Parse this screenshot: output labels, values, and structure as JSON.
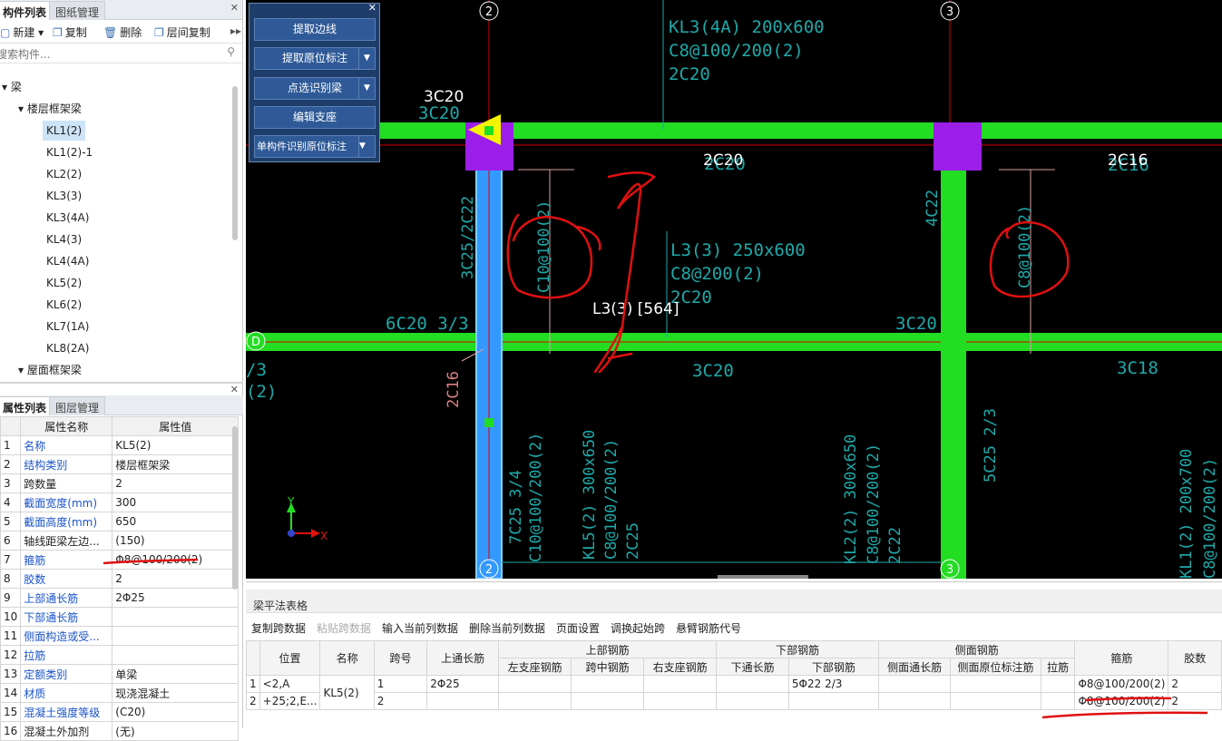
{
  "left_panel": {
    "tabs": [
      "构件列表",
      "图纸管理"
    ],
    "toolbar": {
      "new": "新建",
      "copy": "复制",
      "delete": "删除",
      "floor_copy": "层间复制",
      "more": "▸▸"
    },
    "search_placeholder": "搜索构件...",
    "tree": {
      "root": "梁",
      "group1": "楼层框架梁",
      "items": [
        "KL1(2)",
        "KL1(2)-1",
        "KL2(2)",
        "KL3(3)",
        "KL3(4A)",
        "KL4(3)",
        "KL4(4A)",
        "KL5(2)",
        "KL6(2)",
        "KL7(1A)",
        "KL8(2A)"
      ],
      "group2": "屋面框架梁"
    }
  },
  "prop_panel": {
    "tabs": [
      "属性列表",
      "图层管理"
    ],
    "headers": [
      "属性名称",
      "属性值"
    ],
    "rows": [
      {
        "n": "1",
        "name": "名称",
        "value": "KL5(2)",
        "blue": true
      },
      {
        "n": "2",
        "name": "结构类别",
        "value": "楼层框架梁",
        "blue": true
      },
      {
        "n": "3",
        "name": "跨数量",
        "value": "2",
        "blue": false
      },
      {
        "n": "4",
        "name": "截面宽度(mm)",
        "value": "300",
        "blue": true
      },
      {
        "n": "5",
        "name": "截面高度(mm)",
        "value": "650",
        "blue": true
      },
      {
        "n": "6",
        "name": "轴线距梁左边...",
        "value": "(150)",
        "blue": false
      },
      {
        "n": "7",
        "name": "箍筋",
        "value": "Φ8@100/200(2)",
        "blue": true
      },
      {
        "n": "8",
        "name": "胶数",
        "value": "2",
        "blue": true
      },
      {
        "n": "9",
        "name": "上部通长筋",
        "value": "2Φ25",
        "blue": true
      },
      {
        "n": "10",
        "name": "下部通长筋",
        "value": "",
        "blue": true
      },
      {
        "n": "11",
        "name": "侧面构造或受...",
        "value": "",
        "blue": true
      },
      {
        "n": "12",
        "name": "拉筋",
        "value": "",
        "blue": true
      },
      {
        "n": "13",
        "name": "定额类别",
        "value": "单梁",
        "blue": true
      },
      {
        "n": "14",
        "name": "材质",
        "value": "现浇混凝土",
        "blue": true
      },
      {
        "n": "15",
        "name": "混凝土强度等级",
        "value": "(C20)",
        "blue": true
      },
      {
        "n": "16",
        "name": "混凝土外加剂",
        "value": "(无)",
        "blue": false
      }
    ]
  },
  "float_panel": {
    "buttons": [
      "提取边线",
      "提取原位标注",
      "点选识别梁",
      "编辑支座",
      "单构件识别原位标注"
    ]
  },
  "cad": {
    "axis_labels": [
      "2",
      "3",
      "D",
      "2",
      "3"
    ],
    "texts": {
      "kl3": "KL3(4A) 200x600",
      "kl3_b": "C8@100/200(2)",
      "kl3_c": "2C20",
      "t3c20_white": "3C20",
      "t3c20_cyan": "3C20",
      "t2c20_white": "2C20",
      "t2c20_cyan": "2C20",
      "t2c16_white": "2C16",
      "t2c16_cyan": "2C16",
      "col_left": "3C25/2C22",
      "stirrup_left": "C10@100(2)",
      "l3": "L3(3) 250x600",
      "l3_b": "C8@200(2)",
      "l3_c": "2C20",
      "l3_label": "L3(3) [564]",
      "col_right": "4C22",
      "stirrup_right": "C8@100(2)",
      "t6c20": "6C20 3/3",
      "t3c20_mid": "3C20",
      "t3c20_bot": "3C20",
      "t3c18": "3C18",
      "left_frag1": "/3",
      "left_frag2": "(2)",
      "t2c16_red": "2C16",
      "kl5_a": "7C25 3/4",
      "kl5_b": "C10@100/200(2)",
      "kl5_c": "KL5(2) 300x650",
      "kl5_d": "C8@100/200(2)",
      "kl5_e": "2C25",
      "kl2_a": "KL2(2) 300x650",
      "kl2_b": "C8@100/200(2)",
      "kl2_c": "2C22",
      "t5c25": "5C25 2/3",
      "kl1_a": "KL1(2) 200x700",
      "kl1_b": "C8@100/200(2)",
      "axis_x": "X",
      "axis_y": "Y"
    }
  },
  "bottom_panel": {
    "title": "梁平法表格",
    "toolbar": [
      "复制跨数据",
      "粘贴跨数据",
      "输入当前列数据",
      "删除当前列数据",
      "页面设置",
      "调换起始跨",
      "悬臂钢筋代号"
    ],
    "headers": {
      "position": "位置",
      "name": "名称",
      "span": "跨号",
      "top_through": "上通长筋",
      "top_group": "上部钢筋",
      "top_left": "左支座钢筋",
      "top_mid": "跨中钢筋",
      "top_right": "右支座钢筋",
      "bot_group": "下部钢筋",
      "bot_through": "下通长筋",
      "bot_bar": "下部钢筋",
      "side_group": "侧面钢筋",
      "side_through": "侧面通长筋",
      "side_inplace": "侧面原位标注筋",
      "tie": "拉筋",
      "stirrup": "箍筋",
      "legs": "胶数"
    },
    "rows": [
      {
        "n": "1",
        "position": "<2,A",
        "name": "KL5(2)",
        "span": "1",
        "top_through": "2Φ25",
        "bot_bar": "5Φ22 2/3",
        "stirrup": "Φ8@100/200(2)",
        "legs": "2"
      },
      {
        "n": "2",
        "position": "+25;2,E...",
        "name": "",
        "span": "2",
        "top_through": "",
        "bot_bar": "",
        "stirrup": "Φ8@100/200(2)",
        "legs": "2"
      }
    ]
  },
  "colors": {
    "beam_green": "#22dd22",
    "column_blue": "#3399ff",
    "support_purple": "#9b1fe8",
    "cad_cyan": "#1fa9a9",
    "annot_red": "#e01010"
  }
}
